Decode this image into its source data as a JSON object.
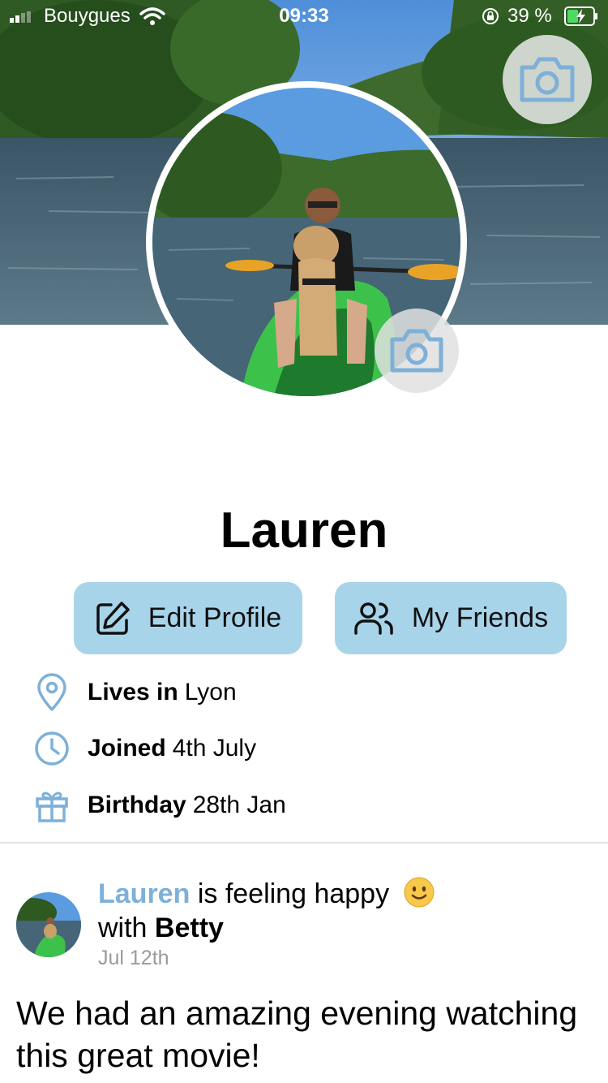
{
  "status_bar": {
    "carrier": "Bouygues",
    "time": "09:33",
    "battery_percent": "39 %"
  },
  "profile": {
    "name": "Lauren",
    "edit_profile_label": "Edit Profile",
    "my_friends_label": "My Friends",
    "lives_in_label": "Lives in",
    "lives_in_value": "Lyon",
    "joined_label": "Joined",
    "joined_value": "4th July",
    "birthday_label": "Birthday",
    "birthday_value": "28th Jan"
  },
  "post": {
    "author": "Lauren",
    "feeling_text": "is feeling happy",
    "with_text": "with",
    "with_name": "Betty",
    "date": "Jul 12th",
    "body": "We had an amazing evening watching this great movie!"
  },
  "colors": {
    "accent": "#7eb0d8",
    "button_bg": "#a8d4ea"
  },
  "icons": [
    "signal-icon",
    "wifi-icon",
    "orientation-lock-icon",
    "battery-icon",
    "camera-icon",
    "edit-icon",
    "friends-icon",
    "location-pin-icon",
    "clock-icon",
    "gift-icon",
    "smiley-emoji-icon"
  ]
}
